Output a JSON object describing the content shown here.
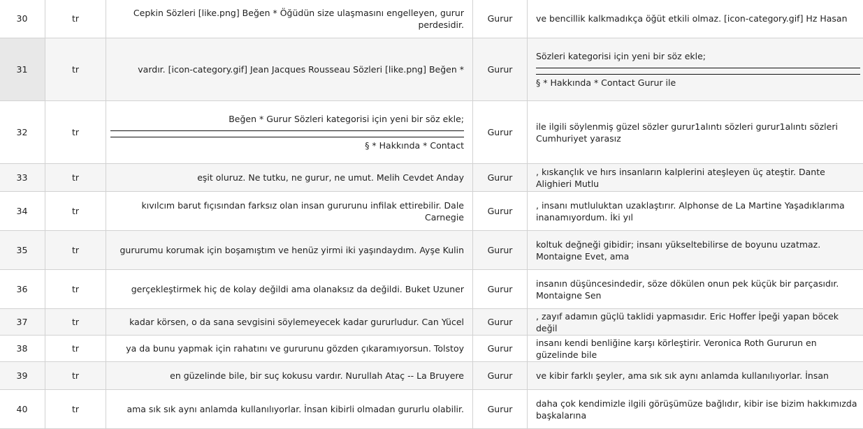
{
  "rows": [
    {
      "id": "30",
      "lang": "tr",
      "left": "Cepkin Sözleri [like.png] Beğen * Öğüdün size ulaşmasını engelleyen, gurur perdesidir.",
      "cat": "Gurur",
      "right": "ve bencillik kalkmadıkça öğüt etkili olmaz. [icon-category.gif] Hz Hasan"
    },
    {
      "id": "31",
      "lang": "tr",
      "left": "vardır. [icon-category.gif] Jean Jacques Rousseau Sözleri [like.png] Beğen *",
      "cat": "Gurur",
      "right_top": "Sözleri kategorisi için yeni bir söz ekle;",
      "right_bottom": "§ * Hakkında * Contact Gurur ile"
    },
    {
      "id": "32",
      "lang": "tr",
      "left_top": "Beğen * Gurur Sözleri kategorisi için yeni bir söz ekle;",
      "left_bottom": "§ * Hakkında * Contact",
      "cat": "Gurur",
      "right": "ile ilgili söylenmiş güzel sözler gurur1alıntı sözleri gurur1alıntı sözleri Cumhuriyet yarasız"
    },
    {
      "id": "33",
      "lang": "tr",
      "left": "eşit oluruz. Ne tutku, ne gurur, ne umut. Melih Cevdet Anday",
      "cat": "Gurur",
      "right": ", kıskançlık ve hırs insanların kalplerini ateşleyen üç ateştir. Dante Alighieri Mutlu"
    },
    {
      "id": "34",
      "lang": "tr",
      "left": "kıvılcım barut fıçısından farksız olan insan gururunu infilak ettirebilir. Dale Carnegie",
      "cat": "Gurur",
      "right": ", insanı mutluluktan uzaklaştırır. Alphonse de La Martine Yaşadıklarıma inanamıyordum. İki yıl"
    },
    {
      "id": "35",
      "lang": "tr",
      "left": "gururumu korumak için boşamıştım ve henüz yirmi iki yaşındaydım. Ayşe Kulin",
      "cat": "Gurur",
      "right": "koltuk değneği gibidir; insanı yükseltebilirse de boyunu uzatmaz. Montaigne Evet, ama"
    },
    {
      "id": "36",
      "lang": "tr",
      "left": "gerçekleştirmek hiç de kolay değildi ama olanaksız da değildi. Buket Uzuner",
      "cat": "Gurur",
      "right": "insanın düşüncesindedir, söze dökülen onun pek küçük bir parçasıdır. Montaigne Sen"
    },
    {
      "id": "37",
      "lang": "tr",
      "left": "kadar körsen, o da sana sevgisini söylemeyecek kadar gururludur. Can Yücel",
      "cat": "Gurur",
      "right": ", zayıf adamın güçlü taklidi yapmasıdır. Eric Hoffer İpeği yapan böcek değil"
    },
    {
      "id": "38",
      "lang": "tr",
      "left": "ya da bunu yapmak için rahatını ve gururunu gözden çıkaramıyorsun. Tolstoy",
      "cat": "Gurur",
      "right": "insanı kendi benliğine karşı körleştirir. Veronica Roth Gururun en güzelinde bile"
    },
    {
      "id": "39",
      "lang": "tr",
      "left": "en güzelinde bile, bir suç kokusu vardır. Nurullah Ataç -- La Bruyere",
      "cat": "Gurur",
      "right": "ve kibir farklı şeyler, ama sık sık aynı anlamda kullanılıyorlar. İnsan"
    },
    {
      "id": "40",
      "lang": "tr",
      "left": "ama sık sık aynı anlamda kullanılıyorlar. İnsan kibirli olmadan gururlu olabilir.",
      "cat": "Gurur",
      "right": "daha çok kendimizle ilgili görüşümüze bağlıdır, kibir ise bizim hakkımızda başkalarına"
    }
  ]
}
